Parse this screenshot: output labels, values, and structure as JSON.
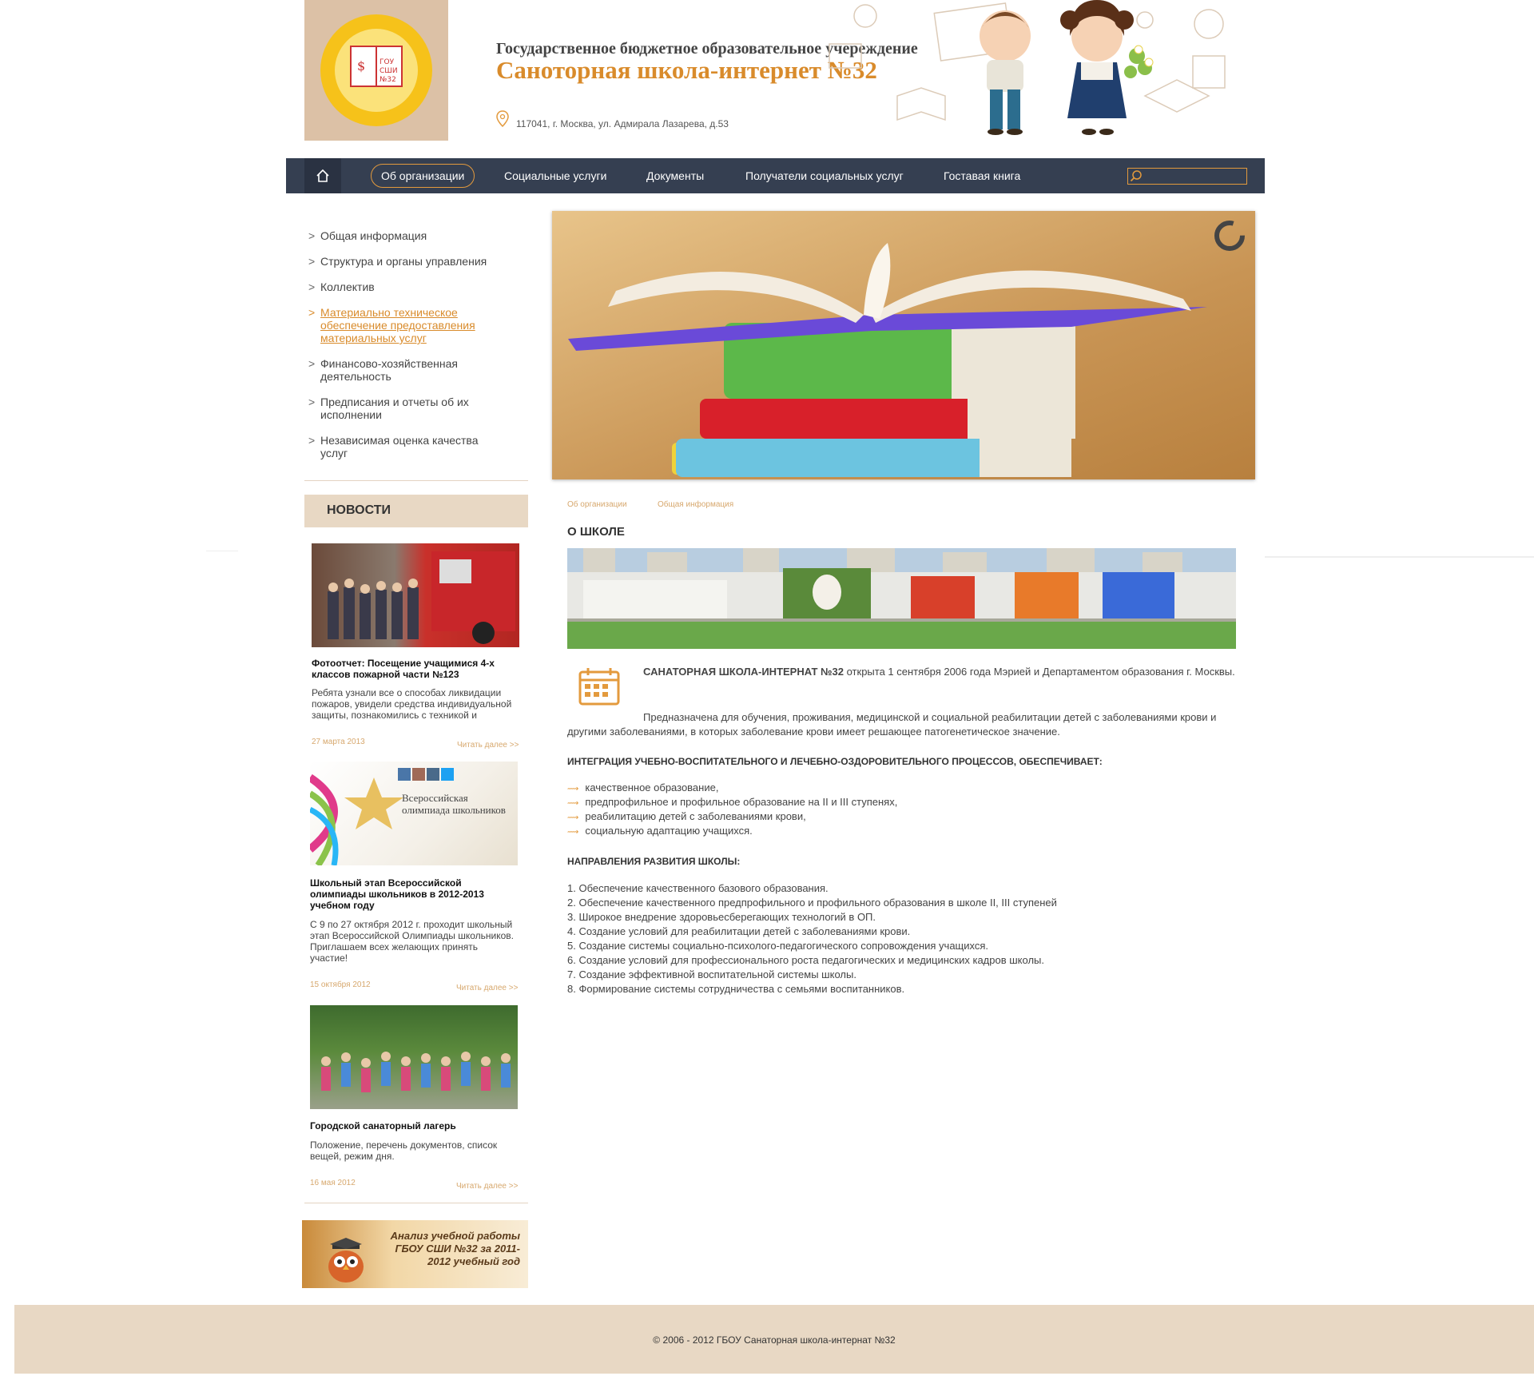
{
  "header": {
    "logo_alt": "ГОУ СШИ №32",
    "subtitle": "Государственное бюджетное образовательное учереждение",
    "title": "Саноторная школа-интернет №32",
    "address": "117041, г. Москва, ул. Адмирала Лазарева, д.53"
  },
  "nav": {
    "items": [
      {
        "label": "Об организации"
      },
      {
        "label": "Социальные услуги"
      },
      {
        "label": "Документы"
      },
      {
        "label": "Получатели социальных услуг"
      },
      {
        "label": "Гоставая книга"
      }
    ],
    "search_placeholder": ""
  },
  "left_menu": {
    "items": [
      {
        "label": "Общая информация"
      },
      {
        "label": "Структура и органы управления"
      },
      {
        "label": "Коллектив"
      },
      {
        "label": "Материально техническое обеспечение предоставления материальных услуг"
      },
      {
        "label": "Финансово-хозяйственная деятельность"
      },
      {
        "label": "Предписания и отчеты об их исполнении"
      },
      {
        "label": "Независимая оценка качества услуг"
      }
    ],
    "active_index": 3
  },
  "news": {
    "heading": "НОВОСТИ",
    "items": [
      {
        "title": "Фотоотчет: Посещение учащимися 4-х классов пожарной части №123",
        "text": "Ребята узнали все о способах ликвидации пожаров, увидели средства индивидуальной защиты, познакомились с техникой и",
        "date": "27 марта 2013",
        "more": "Читать далее >>"
      },
      {
        "title": "Школьный этап Всероссийской олимпиады школьников в 2012-2013 учебном году",
        "text": "С 9 по 27 октября 2012 г. проходит школьный этап Всероссийской Олимпиады школьников. Приглашаем всех желающих принять участие!",
        "date": "15 октября 2012",
        "more": "Читать далее >>",
        "banner_text": "Всероссийская олимпиада школьников"
      },
      {
        "title": "Городской санаторный лагерь",
        "text": "Положение, перечень документов, список вещей, режим дня.",
        "date": "16 мая 2012",
        "more": "Читать далее >>"
      }
    ]
  },
  "promo": {
    "text": "Анализ учебной работы ГБОУ СШИ №32 за 2011-2012 учебный год"
  },
  "breadcrumbs": [
    "Об организации",
    "Общая информация"
  ],
  "main": {
    "heading": "О ШКОЛЕ",
    "intro_bold": "САНАТОРНАЯ ШКОЛА-ИНТЕРНАТ №32",
    "intro_rest": " открыта 1 сентября 2006 года Мэрией и Департаментом образования г. Москвы.",
    "purpose": "Предназначена для обучения, проживания, медицинской и социальной реабилитации детей с заболеваниями крови и другими заболеваниями, в которых заболевание крови имеет решающее патогенетическое значение.",
    "integration_heading": "ИНТЕГРАЦИЯ УЧЕБНО-ВОСПИТАТЕЛЬНОГО И ЛЕЧЕБНО-ОЗДОРОВИТЕЛЬНОГО ПРОЦЕССОВ, ОБЕСПЕЧИВАЕТ:",
    "bullets": [
      "качественное образование,",
      "предпрофильное и профильное образование на II и III ступенях,",
      "реабилитацию детей с заболеваниями крови,",
      "социальную адаптацию учащихся."
    ],
    "directions_heading": "НАПРАВЛЕНИЯ РАЗВИТИЯ ШКОЛЫ:",
    "directions": [
      "1. Обеспечение качественного базового образования.",
      "2. Обеспечение качественного предпрофильного и профильного образования в школе II, III ступеней",
      "3. Широкое внедрение здоровьесберегающих технологий в ОП.",
      "4. Создание условий для реабилитации детей с заболеваниями крови.",
      "5. Создание системы социально-психолого-педагогического сопровождения учащихся.",
      "6. Создание условий для профессионального роста педагогических и медицинских кадров школы.",
      "7. Создание эффективной воспитательной системы школы.",
      "8. Формирование системы сотрудничества с семьями воспитанников."
    ]
  },
  "footer": {
    "copyright": "© 2006 - 2012 ГБОУ Санаторная школа-интернат №32"
  },
  "colors": {
    "accent": "#d98b2b",
    "nav_bg": "#353f51",
    "beige": "#e8d8c4"
  }
}
